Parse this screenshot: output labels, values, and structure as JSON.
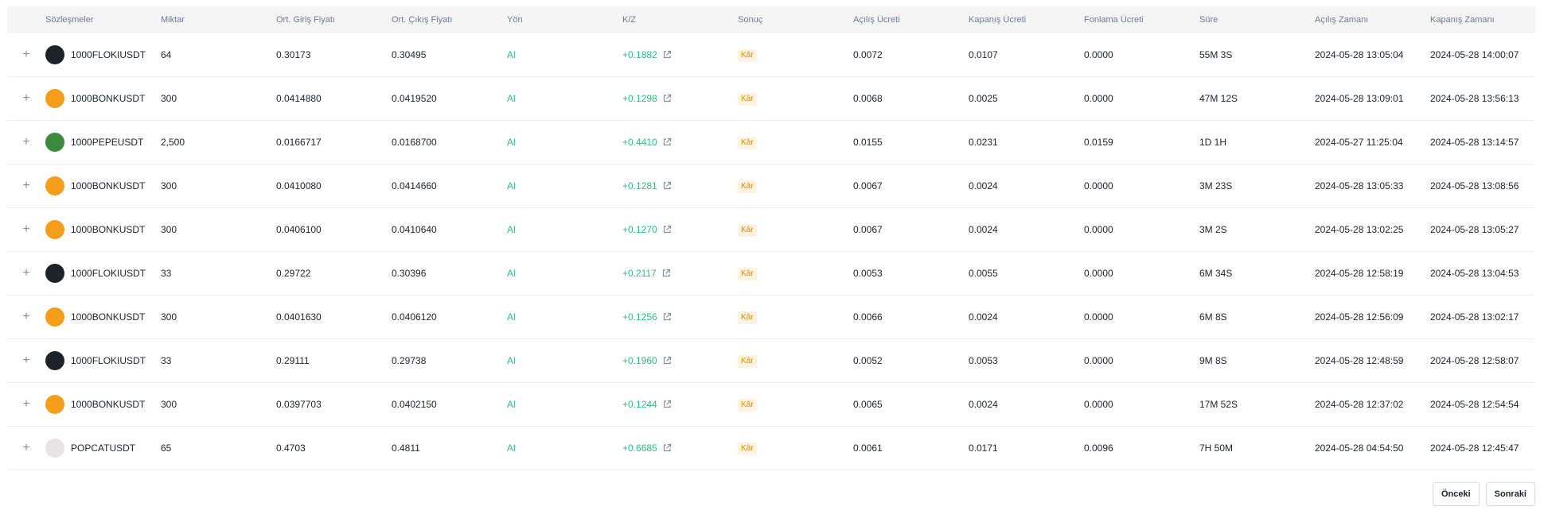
{
  "columns": [
    "Sözleşmeler",
    "Miktar",
    "Ort. Giriş Fiyatı",
    "Ort. Çıkış Fiyatı",
    "Yön",
    "K/Z",
    "Sonuç",
    "Açılış Ücreti",
    "Kapanış Ücreti",
    "Fonlama Ücreti",
    "Süre",
    "Açılış Zamanı",
    "Kapanış Zamanı"
  ],
  "expand_symbol": "+",
  "coin_colors": {
    "floki": "#1e2329",
    "bonk": "#f59e1b",
    "pepe": "#3b8a3e",
    "popcat": "#e8e4e6"
  },
  "coin_icons": {
    "floki": "floki-coin-icon",
    "bonk": "bonk-coin-icon",
    "pepe": "pepe-coin-icon",
    "popcat": "popcat-coin-icon"
  },
  "profit_color": "#2ebd85",
  "badge_color": "#e38a0c",
  "rows": [
    {
      "coin": "floki",
      "symbol": "1000FLOKIUSDT",
      "qty": "64",
      "entry": "0.30173",
      "exit": "0.30495",
      "side": "Al",
      "pnl": "+0.1882",
      "result": "Kâr",
      "open_fee": "0.0072",
      "close_fee": "0.0107",
      "funding_fee": "0.0000",
      "duration": "55M 3S",
      "open_time": "2024-05-28 13:05:04",
      "close_time": "2024-05-28 14:00:07"
    },
    {
      "coin": "bonk",
      "symbol": "1000BONKUSDT",
      "qty": "300",
      "entry": "0.0414880",
      "exit": "0.0419520",
      "side": "Al",
      "pnl": "+0.1298",
      "result": "Kâr",
      "open_fee": "0.0068",
      "close_fee": "0.0025",
      "funding_fee": "0.0000",
      "duration": "47M 12S",
      "open_time": "2024-05-28 13:09:01",
      "close_time": "2024-05-28 13:56:13"
    },
    {
      "coin": "pepe",
      "symbol": "1000PEPEUSDT",
      "qty": "2,500",
      "entry": "0.0166717",
      "exit": "0.0168700",
      "side": "Al",
      "pnl": "+0.4410",
      "result": "Kâr",
      "open_fee": "0.0155",
      "close_fee": "0.0231",
      "funding_fee": "0.0159",
      "duration": "1D 1H",
      "open_time": "2024-05-27 11:25:04",
      "close_time": "2024-05-28 13:14:57"
    },
    {
      "coin": "bonk",
      "symbol": "1000BONKUSDT",
      "qty": "300",
      "entry": "0.0410080",
      "exit": "0.0414660",
      "side": "Al",
      "pnl": "+0.1281",
      "result": "Kâr",
      "open_fee": "0.0067",
      "close_fee": "0.0024",
      "funding_fee": "0.0000",
      "duration": "3M 23S",
      "open_time": "2024-05-28 13:05:33",
      "close_time": "2024-05-28 13:08:56"
    },
    {
      "coin": "bonk",
      "symbol": "1000BONKUSDT",
      "qty": "300",
      "entry": "0.0406100",
      "exit": "0.0410640",
      "side": "Al",
      "pnl": "+0.1270",
      "result": "Kâr",
      "open_fee": "0.0067",
      "close_fee": "0.0024",
      "funding_fee": "0.0000",
      "duration": "3M 2S",
      "open_time": "2024-05-28 13:02:25",
      "close_time": "2024-05-28 13:05:27"
    },
    {
      "coin": "floki",
      "symbol": "1000FLOKIUSDT",
      "qty": "33",
      "entry": "0.29722",
      "exit": "0.30396",
      "side": "Al",
      "pnl": "+0.2117",
      "result": "Kâr",
      "open_fee": "0.0053",
      "close_fee": "0.0055",
      "funding_fee": "0.0000",
      "duration": "6M 34S",
      "open_time": "2024-05-28 12:58:19",
      "close_time": "2024-05-28 13:04:53"
    },
    {
      "coin": "bonk",
      "symbol": "1000BONKUSDT",
      "qty": "300",
      "entry": "0.0401630",
      "exit": "0.0406120",
      "side": "Al",
      "pnl": "+0.1256",
      "result": "Kâr",
      "open_fee": "0.0066",
      "close_fee": "0.0024",
      "funding_fee": "0.0000",
      "duration": "6M 8S",
      "open_time": "2024-05-28 12:56:09",
      "close_time": "2024-05-28 13:02:17"
    },
    {
      "coin": "floki",
      "symbol": "1000FLOKIUSDT",
      "qty": "33",
      "entry": "0.29111",
      "exit": "0.29738",
      "side": "Al",
      "pnl": "+0.1960",
      "result": "Kâr",
      "open_fee": "0.0052",
      "close_fee": "0.0053",
      "funding_fee": "0.0000",
      "duration": "9M 8S",
      "open_time": "2024-05-28 12:48:59",
      "close_time": "2024-05-28 12:58:07"
    },
    {
      "coin": "bonk",
      "symbol": "1000BONKUSDT",
      "qty": "300",
      "entry": "0.0397703",
      "exit": "0.0402150",
      "side": "Al",
      "pnl": "+0.1244",
      "result": "Kâr",
      "open_fee": "0.0065",
      "close_fee": "0.0024",
      "funding_fee": "0.0000",
      "duration": "17M 52S",
      "open_time": "2024-05-28 12:37:02",
      "close_time": "2024-05-28 12:54:54"
    },
    {
      "coin": "popcat",
      "symbol": "POPCATUSDT",
      "qty": "65",
      "entry": "0.4703",
      "exit": "0.4811",
      "side": "Al",
      "pnl": "+0.6685",
      "result": "Kâr",
      "open_fee": "0.0061",
      "close_fee": "0.0171",
      "funding_fee": "0.0096",
      "duration": "7H 50M",
      "open_time": "2024-05-28 04:54:50",
      "close_time": "2024-05-28 12:45:47"
    }
  ],
  "pagination": {
    "prev_label": "Önceki",
    "next_label": "Sonraki"
  }
}
